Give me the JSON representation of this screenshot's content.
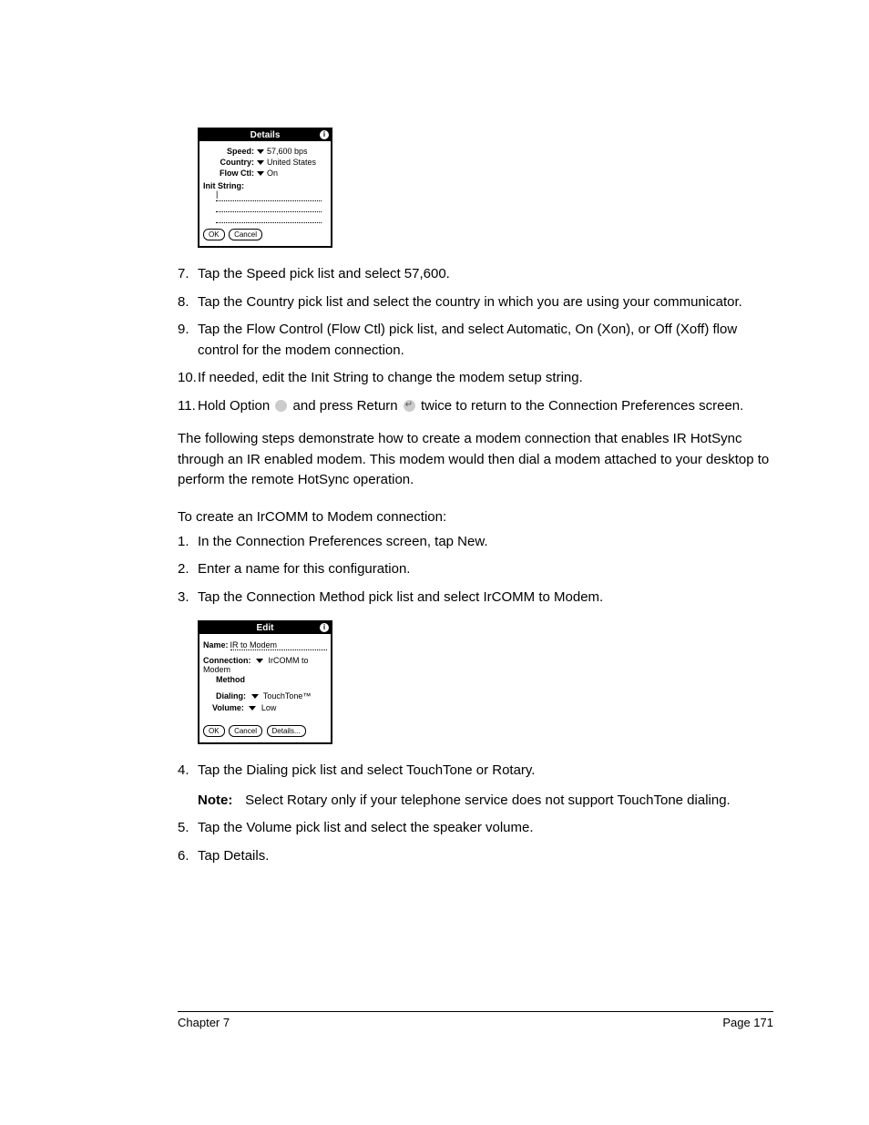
{
  "screenshot1": {
    "title": "Details",
    "speed_label": "Speed:",
    "speed_value": "57,600 bps",
    "country_label": "Country:",
    "country_value": "United States",
    "flowctl_label": "Flow Ctl:",
    "flowctl_value": "On",
    "init_label": "Init String:",
    "btn_ok": "OK",
    "btn_cancel": "Cancel"
  },
  "steps1": {
    "s7": "Tap the Speed pick list and select 57,600.",
    "s8": "Tap the Country pick list and select the country in which you are using your communicator.",
    "s9": "Tap the Flow Control (Flow Ctl) pick list, and select Automatic, On (Xon), or Off (Xoff) flow control for the modem connection.",
    "s10": "If needed, edit the Init String to change the modem setup string.",
    "s11a": "Hold Option ",
    "s11b": " and press Return ",
    "s11c": " twice to return to the Connection Preferences screen."
  },
  "para1": "The following steps demonstrate how to create a modem connection that enables IR HotSync through an IR enabled modem. This modem would then dial a modem attached to your desktop to perform the remote HotSync operation.",
  "subhead": "To create an IrCOMM to Modem connection:",
  "steps2": {
    "s1": "In the Connection Preferences screen, tap New.",
    "s2": "Enter a name for this configuration.",
    "s3": "Tap the Connection Method pick list and select IrCOMM to Modem."
  },
  "screenshot2": {
    "title": "Edit",
    "name_label": "Name:",
    "name_value": "IR to Modem",
    "conn_label": "Connection:",
    "conn_value": "IrCOMM to Modem",
    "method_label": "Method",
    "dialing_label": "Dialing:",
    "dialing_value": "TouchTone™",
    "volume_label": "Volume:",
    "volume_value": "Low",
    "btn_ok": "OK",
    "btn_cancel": "Cancel",
    "btn_details": "Details..."
  },
  "steps3": {
    "s4": "Tap the Dialing pick list and select TouchTone or Rotary.",
    "note_label": "Note:",
    "note_text": "Select Rotary only if your telephone service does not support TouchTone dialing.",
    "s5": "Tap the Volume pick list and select the speaker volume.",
    "s6": "Tap Details."
  },
  "footer": {
    "chapter": "Chapter 7",
    "page": "Page 171"
  }
}
